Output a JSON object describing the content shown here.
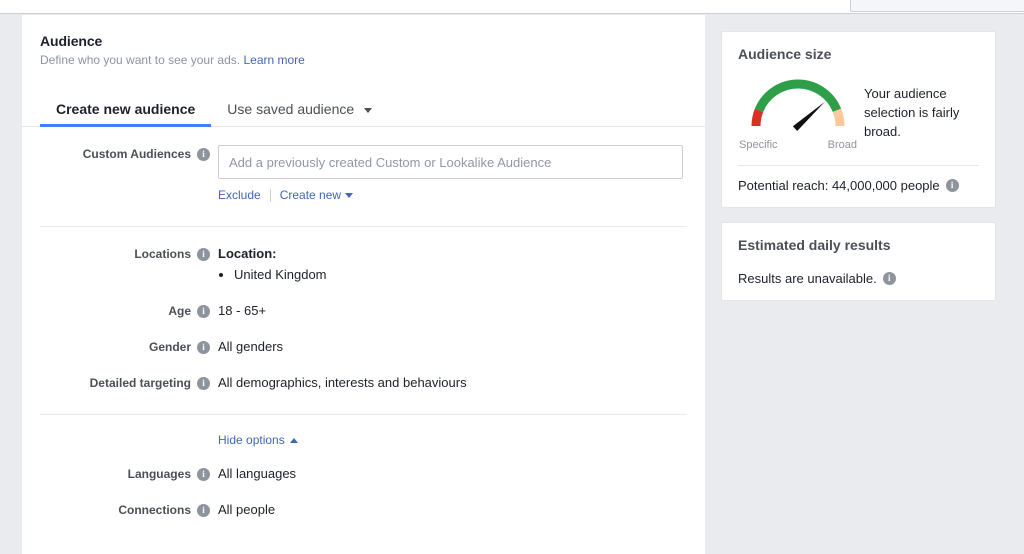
{
  "header": {
    "title": "Audience",
    "subtitle_text": "Define who you want to see your ads.",
    "learn_more_label": "Learn more"
  },
  "tabs": [
    {
      "label": "Create new audience",
      "active": true
    },
    {
      "label": "Use saved audience",
      "active": false,
      "has_caret": true
    }
  ],
  "form": {
    "custom_audiences": {
      "label": "Custom Audiences",
      "placeholder": "Add a previously created Custom or Lookalike Audience",
      "value": "",
      "exclude_label": "Exclude",
      "create_new_label": "Create new"
    },
    "locations": {
      "label": "Locations",
      "value_title": "Location:",
      "items": [
        "United Kingdom"
      ]
    },
    "age": {
      "label": "Age",
      "value": "18 - 65+"
    },
    "gender": {
      "label": "Gender",
      "value": "All genders"
    },
    "detailed_targeting": {
      "label": "Detailed targeting",
      "value": "All demographics, interests and behaviours"
    },
    "hide_options_label": "Hide options",
    "languages": {
      "label": "Languages",
      "value": "All languages"
    },
    "connections": {
      "label": "Connections",
      "value": "All people"
    }
  },
  "sidebar": {
    "audience_size": {
      "title": "Audience size",
      "gauge": {
        "specific_label": "Specific",
        "broad_label": "Broad",
        "needle_angle_deg": 42,
        "segments": [
          {
            "name": "specific",
            "color": "#d93025",
            "start_deg": 180,
            "end_deg": 158
          },
          {
            "name": "middle",
            "color": "#2e9e48",
            "start_deg": 158,
            "end_deg": 22
          },
          {
            "name": "broad",
            "color": "#fbc999",
            "start_deg": 22,
            "end_deg": 0
          }
        ]
      },
      "verdict": "Your audience selection is fairly broad.",
      "potential_reach": "Potential reach: 44,000,000 people"
    },
    "estimated_daily_results": {
      "title": "Estimated daily results",
      "status": "Results are unavailable."
    }
  },
  "icons": {
    "info": "i"
  }
}
